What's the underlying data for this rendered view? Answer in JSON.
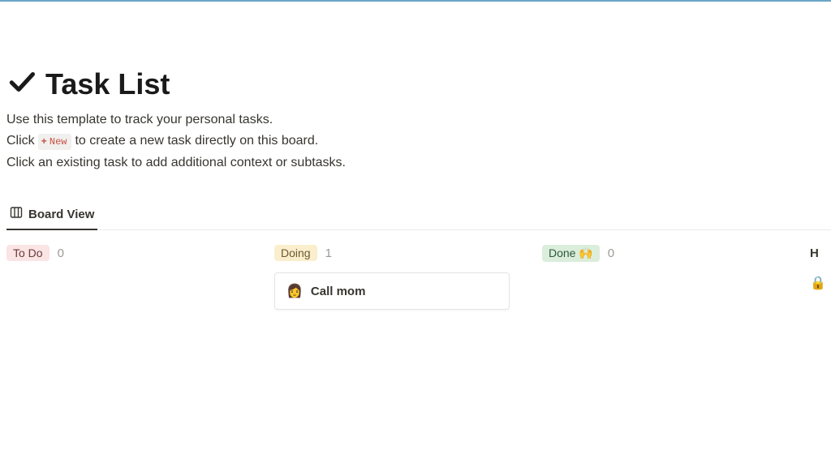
{
  "page": {
    "icon": "check",
    "title": "Task List",
    "description": {
      "line1": "Use this template to track your personal tasks.",
      "line2_pre": "Click",
      "line2_chip_plus": "+",
      "line2_chip_text": "New",
      "line2_post": "to create a new task directly on this board.",
      "line3": "Click an existing task to add additional context or subtasks."
    }
  },
  "views": {
    "active": {
      "icon": "board",
      "label": "Board View"
    }
  },
  "board": {
    "columns": [
      {
        "id": "todo",
        "label": "To Do",
        "pill_class": "pill-todo",
        "count": "0",
        "cards": []
      },
      {
        "id": "doing",
        "label": "Doing",
        "pill_class": "pill-doing",
        "count": "1",
        "cards": [
          {
            "emoji": "👩",
            "title": "Call mom"
          }
        ]
      },
      {
        "id": "done",
        "label": "Done 🙌",
        "pill_class": "pill-done",
        "count": "0",
        "cards": []
      }
    ],
    "overflow": {
      "hint_char": "H",
      "lock_icon": "🔒"
    }
  }
}
